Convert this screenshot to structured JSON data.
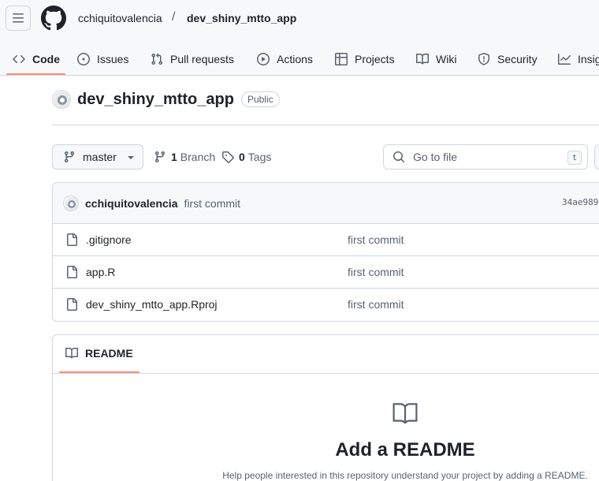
{
  "header": {
    "owner": "cchiquitovalencia",
    "separator": "/",
    "repo": "dev_shiny_mtto_app"
  },
  "tabs": [
    {
      "label": "Code",
      "icon": "code-icon",
      "active": true
    },
    {
      "label": "Issues",
      "icon": "issue-opened-icon"
    },
    {
      "label": "Pull requests",
      "icon": "git-pull-request-icon"
    },
    {
      "label": "Actions",
      "icon": "play-icon"
    },
    {
      "label": "Projects",
      "icon": "table-icon"
    },
    {
      "label": "Wiki",
      "icon": "book-icon"
    },
    {
      "label": "Security",
      "icon": "shield-icon"
    },
    {
      "label": "Insights",
      "icon": "graph-icon"
    }
  ],
  "repo": {
    "name": "dev_shiny_mtto_app",
    "visibility": "Public"
  },
  "toolbar": {
    "branch": "master",
    "branch_count": "1",
    "branch_label": "Branch",
    "tag_count": "0",
    "tag_label": "Tags",
    "goto_placeholder": "Go to file",
    "goto_shortcut": "t"
  },
  "commit": {
    "author": "cchiquitovalencia",
    "message": "first commit",
    "sha": "34ae989"
  },
  "files": [
    {
      "name": ".gitignore",
      "commit": "first commit"
    },
    {
      "name": "app.R",
      "commit": "first commit"
    },
    {
      "name": "dev_shiny_mtto_app.Rproj",
      "commit": "first commit"
    }
  ],
  "readme": {
    "tab_label": "README",
    "title": "Add a README",
    "description": "Help people interested in this repository understand your project by adding a README."
  },
  "colors": {
    "accent_underline": "#fd8c73",
    "border": "#d0d7de",
    "muted_text": "#59636e",
    "header_bg": "#f6f8fa"
  }
}
